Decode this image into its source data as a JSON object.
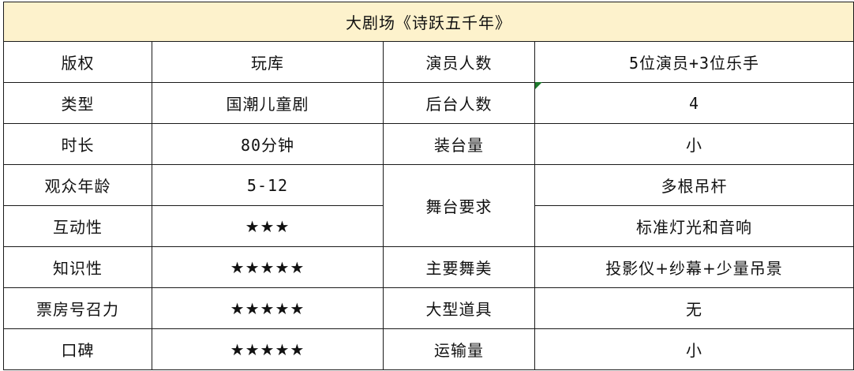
{
  "title": "大剧场《诗跃五千年》",
  "rows": [
    {
      "label": "版权",
      "value": "玩库",
      "label2": "演员人数",
      "value2": "5位演员+3位乐手"
    },
    {
      "label": "类型",
      "value": "国潮儿童剧",
      "label2": "后台人数",
      "value2": "4"
    },
    {
      "label": "时长",
      "value": "80分钟",
      "label2": "装台量",
      "value2": "小"
    },
    {
      "label": "观众年龄",
      "value": "5-12",
      "label2": "舞台要求",
      "value2": "多根吊杆"
    },
    {
      "label": "互动性",
      "value": "★★★",
      "rating": 3,
      "value2": "标准灯光和音响"
    },
    {
      "label": "知识性",
      "value": "★★★★★",
      "rating": 5,
      "label2": "主要舞美",
      "value2": "投影仪+纱幕+少量吊景"
    },
    {
      "label": "票房号召力",
      "value": "★★★★★",
      "rating": 5,
      "label2": "大型道具",
      "value2": "无"
    },
    {
      "label": "口碑",
      "value": "★★★★★",
      "rating": 5,
      "label2": "运输量",
      "value2": "小"
    }
  ]
}
